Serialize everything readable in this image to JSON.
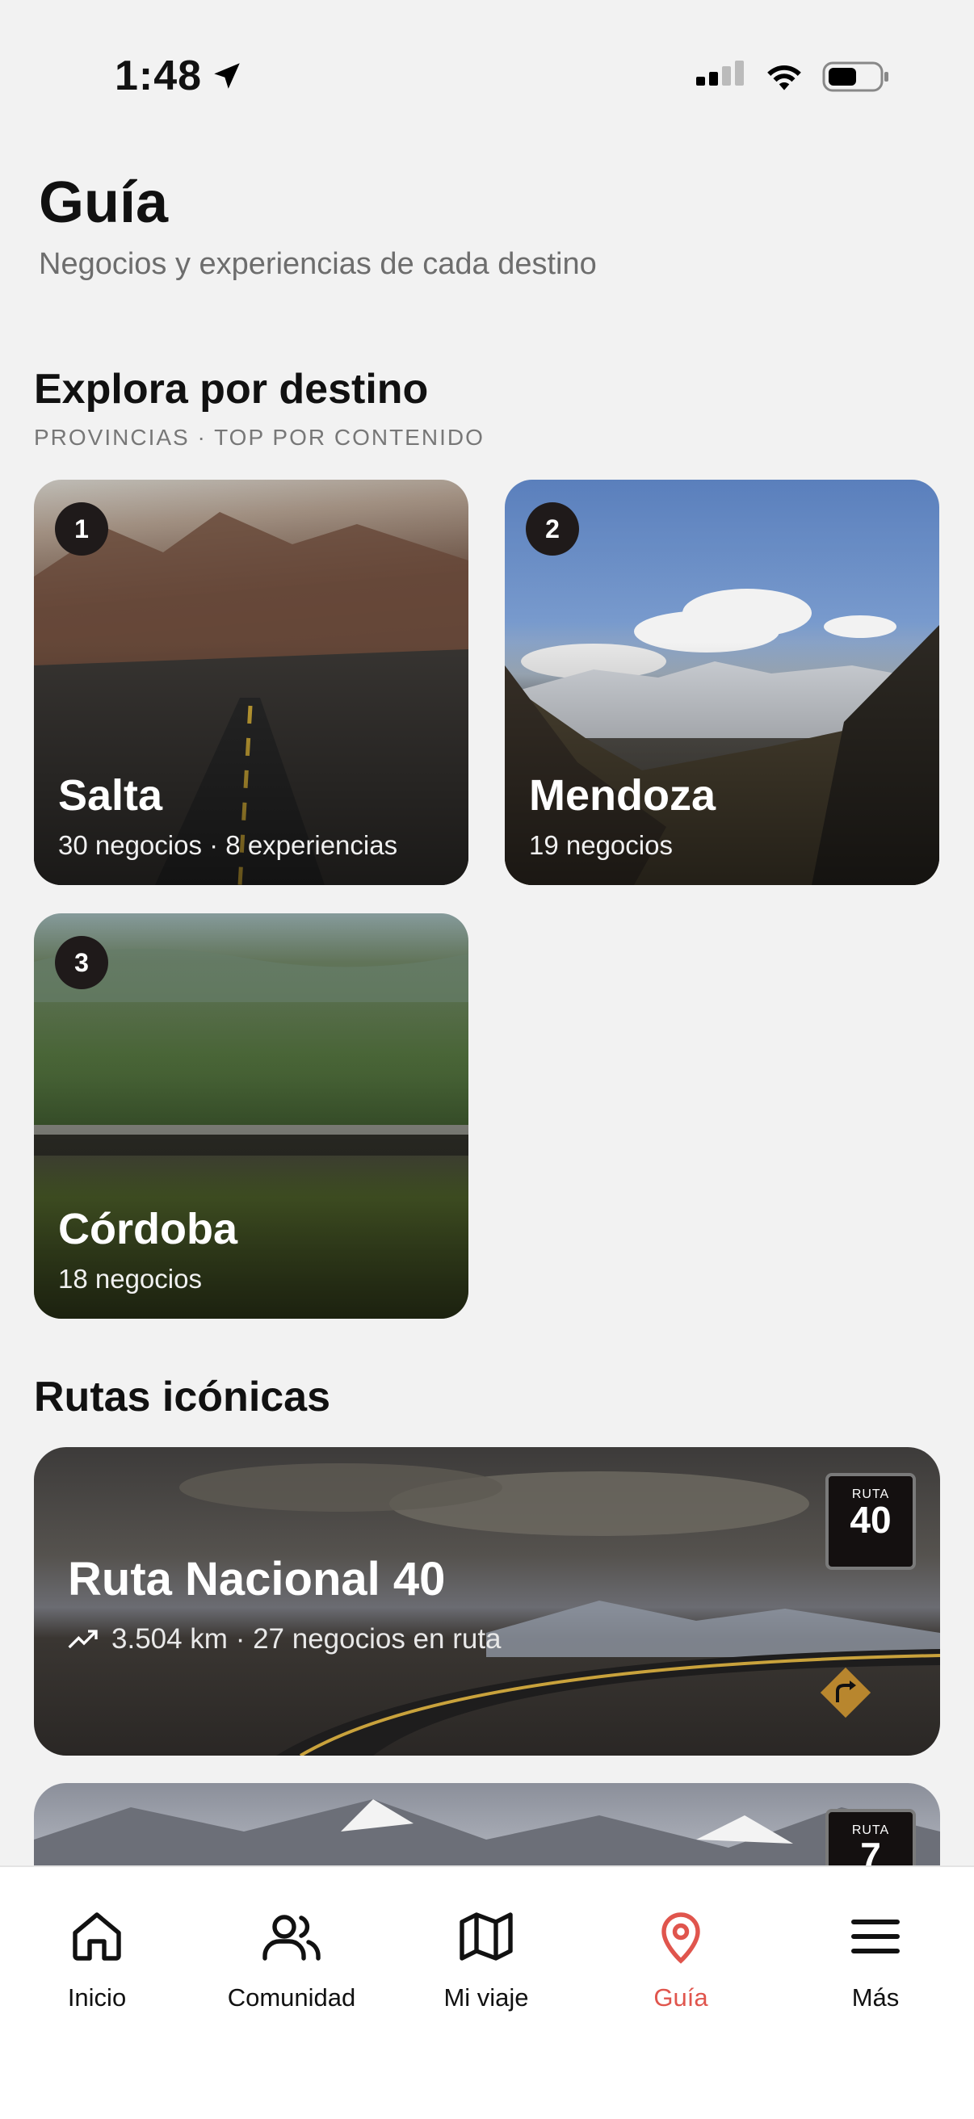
{
  "status": {
    "time": "1:48"
  },
  "header": {
    "title": "Guía",
    "subtitle": "Negocios y experiencias de cada destino"
  },
  "explore": {
    "title": "Explora por destino",
    "caption": "PROVINCIAS · TOP POR CONTENIDO",
    "destinations": [
      {
        "rank": "1",
        "name": "Salta",
        "meta": "30 negocios · 8 experiencias"
      },
      {
        "rank": "2",
        "name": "Mendoza",
        "meta": "19 negocios"
      },
      {
        "rank": "3",
        "name": "Córdoba",
        "meta": "18 negocios"
      }
    ]
  },
  "routes": {
    "title": "Rutas icónicas",
    "items": [
      {
        "name": "Ruta Nacional 40",
        "meta": "3.504 km · 27 negocios en ruta",
        "sign_label": "RUTA",
        "sign_number": "40"
      },
      {
        "name": "",
        "meta": "",
        "sign_label": "RUTA",
        "sign_number": "7"
      }
    ]
  },
  "tabbar": {
    "active_color": "#e0554d",
    "tabs": [
      {
        "label": "Inicio",
        "icon": "home-icon"
      },
      {
        "label": "Comunidad",
        "icon": "community-icon"
      },
      {
        "label": "Mi viaje",
        "icon": "map-icon"
      },
      {
        "label": "Guía",
        "icon": "location-pin-icon"
      },
      {
        "label": "Más",
        "icon": "menu-icon"
      }
    ]
  }
}
